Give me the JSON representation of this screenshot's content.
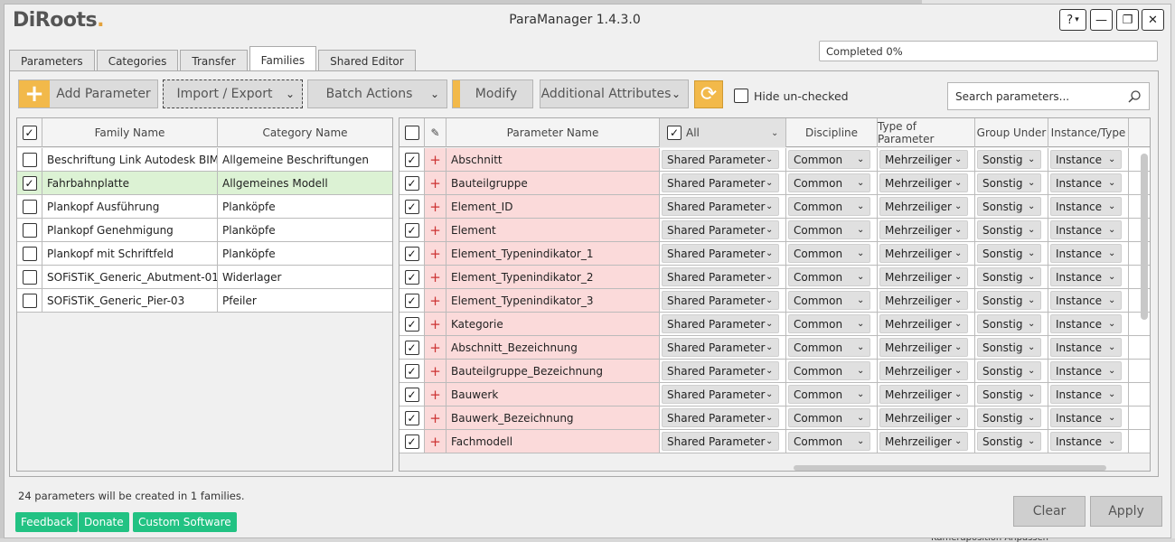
{
  "app": {
    "logo_text": "DiRoots",
    "logo_dot": ".",
    "title": "ParaManager 1.4.3.0"
  },
  "window_controls": {
    "help": "?",
    "help_chevron": "▾",
    "minimize": "—",
    "restore": "❐",
    "close": "✕"
  },
  "progress": {
    "text": "Completed 0%",
    "value": 0
  },
  "tabs": [
    {
      "label": "Parameters",
      "active": false
    },
    {
      "label": "Categories",
      "active": false
    },
    {
      "label": "Transfer",
      "active": false
    },
    {
      "label": "Families",
      "active": true
    },
    {
      "label": "Shared Editor",
      "active": false
    }
  ],
  "toolbar": {
    "add_parameter": "Add Parameter",
    "import_export": "Import / Export",
    "batch_actions": "Batch Actions",
    "modify": "Modify",
    "additional_attributes": "Additional Attributes",
    "hide_unchecked": "Hide un-checked",
    "search_placeholder": "Search parameters...",
    "accent_color": "#f2b94a"
  },
  "families": {
    "headers": {
      "family": "Family Name",
      "category": "Category Name"
    },
    "header_checked": true,
    "rows": [
      {
        "checked": false,
        "family": "Beschriftung Link Autodesk BIM Europe",
        "category": "Allgemeine Beschriftungen",
        "selected": false
      },
      {
        "checked": true,
        "family": "Fahrbahnplatte",
        "category": "Allgemeines Modell",
        "selected": true
      },
      {
        "checked": false,
        "family": "Plankopf Ausführung",
        "category": "Planköpfe",
        "selected": false
      },
      {
        "checked": false,
        "family": "Plankopf Genehmigung",
        "category": "Planköpfe",
        "selected": false
      },
      {
        "checked": false,
        "family": "Plankopf mit Schriftfeld",
        "category": "Planköpfe",
        "selected": false
      },
      {
        "checked": false,
        "family": "SOFiSTiK_Generic_Abutment-01",
        "category": "Widerlager",
        "selected": false
      },
      {
        "checked": false,
        "family": "SOFiSTiK_Generic_Pier-03",
        "category": "Pfeiler",
        "selected": false
      }
    ]
  },
  "parameters": {
    "headers": {
      "name": "Parameter Name",
      "all": "All",
      "discipline": "Discipline",
      "type": "Type of Parameter",
      "group": "Group Under",
      "instance": "Instance/Type"
    },
    "rows": [
      {
        "checked": true,
        "name": "Abschnitt",
        "kind": "Shared Parameter",
        "discipline": "Common",
        "type": "Mehrzeiliger",
        "group": "Sonstig",
        "instance": "Instance"
      },
      {
        "checked": true,
        "name": "Bauteilgruppe",
        "kind": "Shared Parameter",
        "discipline": "Common",
        "type": "Mehrzeiliger",
        "group": "Sonstig",
        "instance": "Instance"
      },
      {
        "checked": true,
        "name": "Element_ID",
        "kind": "Shared Parameter",
        "discipline": "Common",
        "type": "Mehrzeiliger",
        "group": "Sonstig",
        "instance": "Instance"
      },
      {
        "checked": true,
        "name": "Element",
        "kind": "Shared Parameter",
        "discipline": "Common",
        "type": "Mehrzeiliger",
        "group": "Sonstig",
        "instance": "Instance"
      },
      {
        "checked": true,
        "name": "Element_Typenindikator_1",
        "kind": "Shared Parameter",
        "discipline": "Common",
        "type": "Mehrzeiliger",
        "group": "Sonstig",
        "instance": "Instance"
      },
      {
        "checked": true,
        "name": "Element_Typenindikator_2",
        "kind": "Shared Parameter",
        "discipline": "Common",
        "type": "Mehrzeiliger",
        "group": "Sonstig",
        "instance": "Instance"
      },
      {
        "checked": true,
        "name": "Element_Typenindikator_3",
        "kind": "Shared Parameter",
        "discipline": "Common",
        "type": "Mehrzeiliger",
        "group": "Sonstig",
        "instance": "Instance"
      },
      {
        "checked": true,
        "name": "Kategorie",
        "kind": "Shared Parameter",
        "discipline": "Common",
        "type": "Mehrzeiliger",
        "group": "Sonstig",
        "instance": "Instance"
      },
      {
        "checked": true,
        "name": "Abschnitt_Bezeichnung",
        "kind": "Shared Parameter",
        "discipline": "Common",
        "type": "Mehrzeiliger",
        "group": "Sonstig",
        "instance": "Instance"
      },
      {
        "checked": true,
        "name": "Bauteilgruppe_Bezeichnung",
        "kind": "Shared Parameter",
        "discipline": "Common",
        "type": "Mehrzeiliger",
        "group": "Sonstig",
        "instance": "Instance"
      },
      {
        "checked": true,
        "name": "Bauwerk",
        "kind": "Shared Parameter",
        "discipline": "Common",
        "type": "Mehrzeiliger",
        "group": "Sonstig",
        "instance": "Instance"
      },
      {
        "checked": true,
        "name": "Bauwerk_Bezeichnung",
        "kind": "Shared Parameter",
        "discipline": "Common",
        "type": "Mehrzeiliger",
        "group": "Sonstig",
        "instance": "Instance"
      },
      {
        "checked": true,
        "name": "Fachmodell",
        "kind": "Shared Parameter",
        "discipline": "Common",
        "type": "Mehrzeiliger",
        "group": "Sonstig",
        "instance": "Instance"
      }
    ]
  },
  "status_text": "24 parameters will be created in 1 families.",
  "footer_links": {
    "feedback": "Feedback",
    "donate": "Donate",
    "custom_software": "Custom Software"
  },
  "footer_buttons": {
    "clear": "Clear",
    "apply": "Apply"
  },
  "background_peek_text": "Kameraposition   Anpassen"
}
